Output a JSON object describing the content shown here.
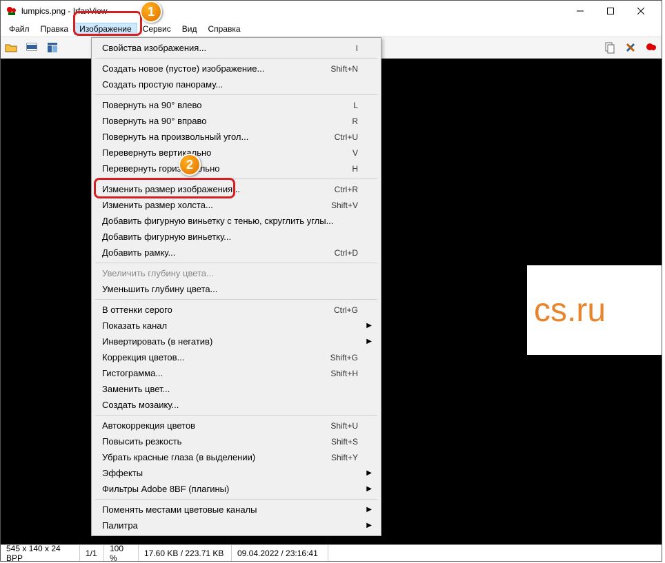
{
  "titlebar": {
    "title": "lumpics.png - IrfanView"
  },
  "menubar": {
    "file": "Файл",
    "edit": "Правка",
    "image": "Изображение",
    "service": "Сервис",
    "view": "Вид",
    "help": "Справка"
  },
  "dropdown": {
    "items": [
      {
        "label": "Свойства изображения...",
        "shortcut": "I"
      },
      {
        "sep": true
      },
      {
        "label": "Создать новое (пустое) изображение...",
        "shortcut": "Shift+N"
      },
      {
        "label": "Создать простую панораму..."
      },
      {
        "sep": true
      },
      {
        "label": "Повернуть на 90° влево",
        "shortcut": "L"
      },
      {
        "label": "Повернуть на 90° вправо",
        "shortcut": "R"
      },
      {
        "label": "Повернуть на произвольный угол...",
        "shortcut": "Ctrl+U"
      },
      {
        "label": "Перевернуть вертикально",
        "shortcut": "V"
      },
      {
        "label": "Перевернуть горизонтально",
        "shortcut": "H"
      },
      {
        "sep": true
      },
      {
        "label": "Изменить размер изображения...",
        "shortcut": "Ctrl+R"
      },
      {
        "label": "Изменить размер холста...",
        "shortcut": "Shift+V"
      },
      {
        "label": "Добавить фигурную виньетку с тенью, скруглить углы..."
      },
      {
        "label": "Добавить фигурную виньетку..."
      },
      {
        "label": "Добавить рамку...",
        "shortcut": "Ctrl+D"
      },
      {
        "sep": true
      },
      {
        "label": "Увеличить глубину цвета...",
        "disabled": true
      },
      {
        "label": "Уменьшить глубину цвета..."
      },
      {
        "sep": true
      },
      {
        "label": "В оттенки серого",
        "shortcut": "Ctrl+G"
      },
      {
        "label": "Показать канал",
        "submenu": true
      },
      {
        "label": "Инвертировать (в негатив)",
        "submenu": true
      },
      {
        "label": "Коррекция цветов...",
        "shortcut": "Shift+G"
      },
      {
        "label": "Гистограмма...",
        "shortcut": "Shift+H"
      },
      {
        "label": "Заменить цвет..."
      },
      {
        "label": "Создать мозаику..."
      },
      {
        "sep": true
      },
      {
        "label": "Автокоррекция цветов",
        "shortcut": "Shift+U"
      },
      {
        "label": "Повысить резкость",
        "shortcut": "Shift+S"
      },
      {
        "label": "Убрать красные глаза (в выделении)",
        "shortcut": "Shift+Y"
      },
      {
        "label": "Эффекты",
        "submenu": true
      },
      {
        "label": "Фильтры Adobe 8BF (плагины)",
        "submenu": true
      },
      {
        "sep": true
      },
      {
        "label": "Поменять местами цветовые каналы",
        "submenu": true
      },
      {
        "label": "Палитра",
        "submenu": true
      }
    ]
  },
  "preview": {
    "text": "cs.ru"
  },
  "badges": {
    "b1": "1",
    "b2": "2"
  },
  "statusbar": {
    "dims": "545 x 140 x 24 BPP",
    "page": "1/1",
    "zoom": "100 %",
    "size": "17.60 KB / 223.71 KB",
    "date": "09.04.2022 / 23:16:41"
  }
}
